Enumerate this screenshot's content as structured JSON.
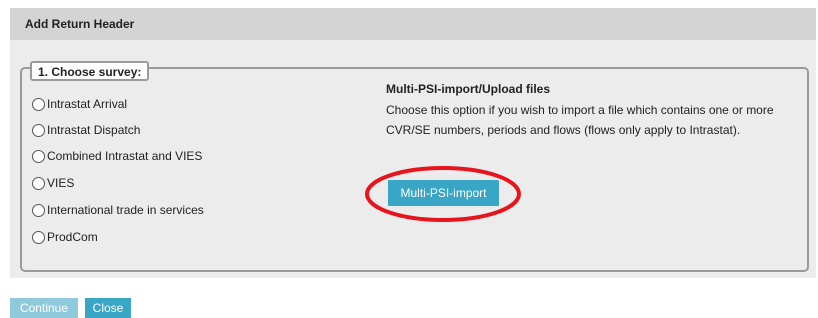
{
  "dialog": {
    "title": "Add Return Header"
  },
  "survey": {
    "legend": "1. Choose survey:",
    "options": [
      {
        "label": "Intrastat Arrival",
        "selected": false
      },
      {
        "label": "Intrastat Dispatch",
        "selected": false
      },
      {
        "label": "Combined Intrastat and VIES",
        "selected": false
      },
      {
        "label": "VIES",
        "selected": false
      },
      {
        "label": "International trade in services",
        "selected": false
      },
      {
        "label": "ProdCom",
        "selected": false
      }
    ]
  },
  "multi_psi": {
    "title": "Multi-PSI-import/Upload files",
    "description": "Choose this option if you wish to import a file which contains one or more CVR/SE numbers, periods and flows (flows only apply to Intrastat).",
    "button_label": "Multi-PSI-import",
    "highlight_color": "#e8141c"
  },
  "footer": {
    "continue_label": "Continue",
    "close_label": "Close"
  },
  "colors": {
    "accent": "#3aa6c6",
    "accent_disabled": "#8fc9dc",
    "header_bg": "#d4d4d4",
    "panel_bg": "#ececec"
  }
}
